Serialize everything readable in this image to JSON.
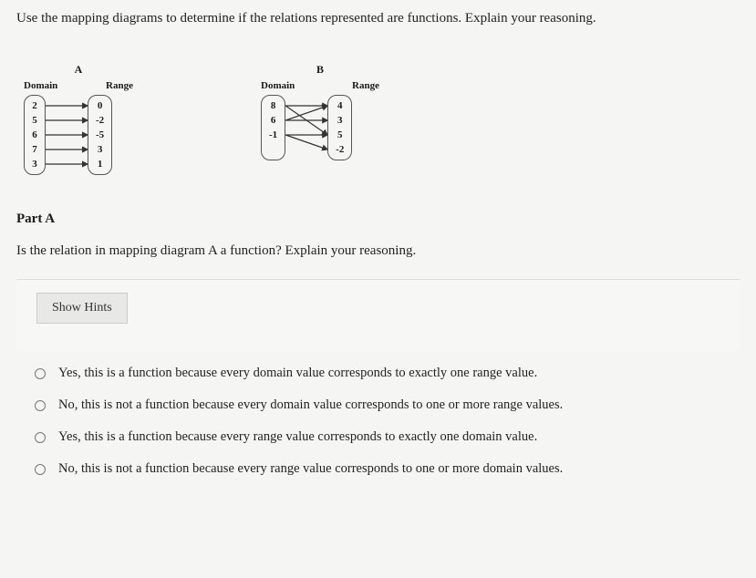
{
  "instruction": "Use the mapping diagrams to determine if the relations represented are functions. Explain your reasoning.",
  "diagrams": {
    "a": {
      "title": "A",
      "domainLabel": "Domain",
      "rangeLabel": "Range",
      "domain": [
        "2",
        "5",
        "6",
        "7",
        "3"
      ],
      "range": [
        "0",
        "-2",
        "-5",
        "3",
        "1"
      ],
      "mappings": [
        [
          0,
          0
        ],
        [
          1,
          1
        ],
        [
          2,
          2
        ],
        [
          3,
          3
        ],
        [
          4,
          4
        ]
      ]
    },
    "b": {
      "title": "B",
      "domainLabel": "Domain",
      "rangeLabel": "Range",
      "domain": [
        "8",
        "6",
        "-1"
      ],
      "range": [
        "4",
        "3",
        "5",
        "-2"
      ],
      "mappings": [
        [
          0,
          0
        ],
        [
          0,
          2
        ],
        [
          1,
          0
        ],
        [
          1,
          1
        ],
        [
          2,
          2
        ],
        [
          2,
          3
        ]
      ]
    }
  },
  "partHeading": "Part A",
  "questionText": "Is the relation in mapping diagram A a function? Explain your reasoning.",
  "showHints": "Show Hints",
  "options": [
    "Yes, this is a function because every domain value corresponds to exactly one range value.",
    "No, this is not a function because every domain value corresponds to one or more range values.",
    "Yes, this is a function because every range value corresponds to exactly one domain value.",
    "No, this is not a function because every range value corresponds to one or more domain values."
  ]
}
